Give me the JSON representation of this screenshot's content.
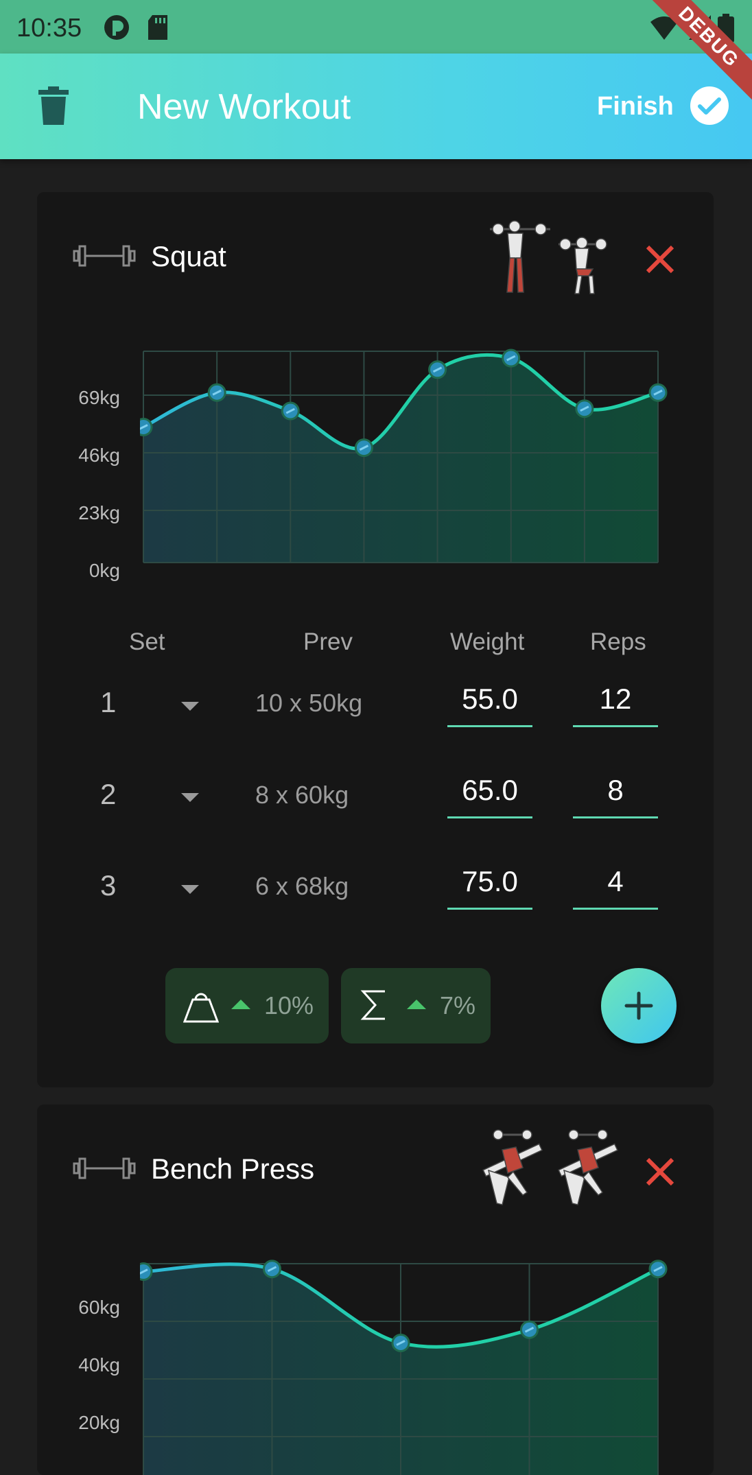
{
  "status_bar": {
    "time": "10:35"
  },
  "debug_ribbon": "DEBUG",
  "app_bar": {
    "title": "New Workout",
    "finish_label": "Finish"
  },
  "exercises": [
    {
      "name": "Squat",
      "chart_data": {
        "type": "line",
        "y_ticks": [
          "69kg",
          "46kg",
          "23kg",
          "0kg"
        ],
        "ylim": [
          0,
          92
        ],
        "values": [
          59,
          74,
          66,
          50,
          84,
          89,
          67,
          74
        ],
        "grid": true
      },
      "table": {
        "headers": [
          "Set",
          "Prev",
          "Weight",
          "Reps"
        ],
        "rows": [
          {
            "set": "1",
            "prev": "10 x 50kg",
            "weight": "55.0",
            "reps": "12"
          },
          {
            "set": "2",
            "prev": "8 x 60kg",
            "weight": "65.0",
            "reps": "8"
          },
          {
            "set": "3",
            "prev": "6 x 68kg",
            "weight": "75.0",
            "reps": "4"
          }
        ]
      },
      "stats": {
        "weight_change": "10%",
        "volume_change": "7%"
      }
    },
    {
      "name": "Bench Press",
      "chart_data": {
        "type": "line",
        "y_ticks": [
          "60kg",
          "40kg",
          "20kg"
        ],
        "ylim": [
          0,
          80
        ],
        "values": [
          77,
          78,
          50,
          55,
          78
        ],
        "grid": true
      }
    }
  ],
  "colors": {
    "accent": "#5fd9b2",
    "appbar_start": "#5fe0c2",
    "appbar_end": "#46c8f2",
    "delete": "#e5483d",
    "increase": "#49c46b"
  }
}
